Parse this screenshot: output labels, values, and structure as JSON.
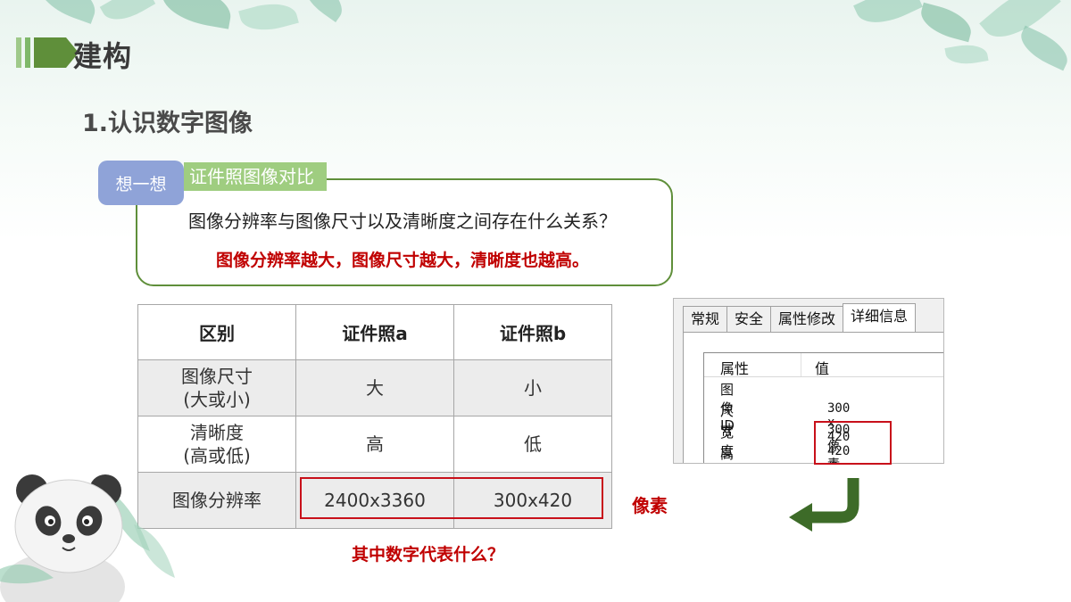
{
  "header": {
    "title": "建构"
  },
  "section": {
    "title": "1.认识数字图像"
  },
  "think": {
    "badge": "想一想",
    "tag": "证件照图像对比",
    "question": "图像分辨率与图像尺寸以及清晰度之间存在什么关系？",
    "answer": "图像分辨率越大，图像尺寸越大，清晰度也越高。"
  },
  "table": {
    "headers": [
      "区别",
      "证件照a",
      "证件照b"
    ],
    "rows": [
      {
        "label": [
          "图像尺寸",
          "(大或小)"
        ],
        "a": "大",
        "b": "小"
      },
      {
        "label": [
          "清晰度",
          "(高或低)"
        ],
        "a": "高",
        "b": "低"
      },
      {
        "label": [
          "图像分辨率"
        ],
        "a": "2400x3360",
        "b": "300x420"
      }
    ]
  },
  "annotations": {
    "pixel": "像素",
    "question": "其中数字代表什么？"
  },
  "dialog": {
    "tabs": [
      "常规",
      "安全",
      "属性修改",
      "详细信息"
    ],
    "active_tab": "详细信息",
    "columns": [
      "属性",
      "值"
    ],
    "rows": [
      {
        "k": "图像 ID",
        "v": ""
      },
      {
        "k": "尺寸",
        "v": "300 x 420"
      },
      {
        "k": "宽度",
        "v": "300 像素"
      },
      {
        "k": "高度",
        "v": "420 像素"
      }
    ]
  },
  "colors": {
    "accent_green": "#5f8f3a",
    "highlight_red": "#c00000",
    "badge_blue": "#8fa3d8",
    "tag_green": "#9fcd80"
  }
}
